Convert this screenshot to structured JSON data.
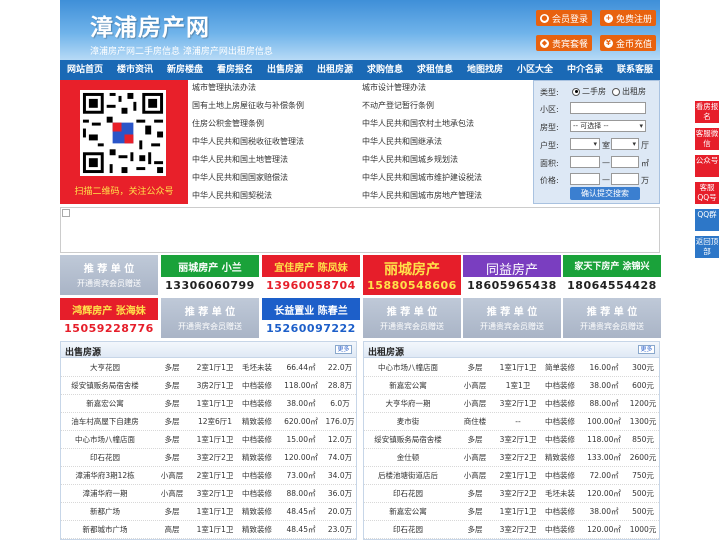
{
  "header": {
    "logo": "漳浦房产网",
    "slogan": "漳浦房产网二手房信息   漳浦房产网出租房信息",
    "buttons": [
      "会员登录",
      "免费注册",
      "贵宾套餐",
      "金币充值"
    ],
    "button_color": "#e8620f"
  },
  "nav": [
    "网站首页",
    "楼市资讯",
    "新房楼盘",
    "看房报名",
    "出售房源",
    "出租房源",
    "求购信息",
    "求租信息",
    "地图找房",
    "小区大全",
    "中介名录",
    "联系客服"
  ],
  "qr": {
    "caption": "扫描二维码，关注公众号"
  },
  "links_left": [
    "城市管理执法办法",
    "国有土地上房屋征收与补偿条例",
    "住房公积金管理条例",
    "中华人民共和国税收征收管理法",
    "中华人民共和国土地管理法",
    "中华人民共和国国家赔偿法",
    "中华人民共和国契税法"
  ],
  "links_right": [
    "城市设计管理办法",
    "不动产登记暂行条例",
    "中华人民共和国农村土地承包法",
    "中华人民共和国继承法",
    "中华人民共和国城乡规划法",
    "中华人民共和国城市维护建设税法",
    "中华人民共和国城市房地产管理法"
  ],
  "search": {
    "type_label": "类型:",
    "type_options": [
      "二手房",
      "出租房"
    ],
    "community_label": "小区:",
    "housetype_label": "房型:",
    "housetype_value": "-- 可选择 --",
    "layout_label": "户型:",
    "layout_unit1": "室",
    "layout_unit2": "厅",
    "area_label": "面积:",
    "area_unit": "㎡",
    "price_label": "价格:",
    "price_unit": "万",
    "submit": "确认提交搜索"
  },
  "ads_row1": [
    {
      "l1": "推 荐 单 位",
      "l2": "开通贵宾会员赠送",
      "style": "gray"
    },
    {
      "l1": "丽城房产   小兰",
      "l2": "13306060799",
      "style": "green"
    },
    {
      "l1": "宜佳房产 陈凤妹",
      "l2": "13960058704",
      "style": "red"
    },
    {
      "l1": "丽城房产",
      "l2": "15880548606",
      "style": "redbig"
    },
    {
      "l1": "同益房产",
      "l2": "18605965438",
      "style": "purple"
    },
    {
      "l1": "家天下房产 涂锦兴",
      "l2": "18064554428",
      "style": "green2"
    }
  ],
  "ads_row2": [
    {
      "l1": "鸿辉房产 张海妹",
      "l2": "15059228776",
      "style": "red"
    },
    {
      "l1": "推 荐 单 位",
      "l2": "开通贵宾会员赠送",
      "style": "gray"
    },
    {
      "l1": "长益置业 陈春兰",
      "l2": "15260097222",
      "style": "blue"
    },
    {
      "l1": "推 荐 单 位",
      "l2": "开通贵宾会员赠送",
      "style": "gray"
    },
    {
      "l1": "推 荐 单 位",
      "l2": "开通贵宾会员赠送",
      "style": "gray"
    },
    {
      "l1": "推 荐 单 位",
      "l2": "开通贵宾会员赠送",
      "style": "gray"
    }
  ],
  "sale": {
    "title": "出售房源",
    "more": "更多",
    "rows": [
      [
        "大亨花园",
        "多层",
        "2室1厅1卫",
        "毛坯未装",
        "66.44㎡",
        "22.0万"
      ],
      [
        "绥安镇贩务局宿舍楼",
        "多层",
        "3房2厅1卫",
        "中档装修",
        "118.00㎡",
        "28.8万"
      ],
      [
        "新嘉宏公寓",
        "多层",
        "1室1厅1卫",
        "中档装修",
        "38.00㎡",
        "6.0万"
      ],
      [
        "油车村高屋下自建房",
        "多层",
        "12室6厅1",
        "精致装修",
        "620.00㎡",
        "176.0万"
      ],
      [
        "中心市场八幢店面",
        "多层",
        "1室1厅1卫",
        "中档装修",
        "15.00㎡",
        "12.0万"
      ],
      [
        "印石花园",
        "多层",
        "3室2厅2卫",
        "精致装修",
        "120.00㎡",
        "74.0万"
      ],
      [
        "漳浦华府3期12栋",
        "小高层",
        "2室1厅1卫",
        "中档装修",
        "73.00㎡",
        "34.0万"
      ],
      [
        "漳浦华府一期",
        "小高层",
        "3室2厅1卫",
        "中档装修",
        "88.00㎡",
        "36.0万"
      ],
      [
        "新都广场",
        "多层",
        "1室1厅1卫",
        "精致装修",
        "48.45㎡",
        "20.0万"
      ],
      [
        "新都城市广场",
        "高层",
        "1室1厅1卫",
        "精致装修",
        "48.45㎡",
        "23.0万"
      ]
    ]
  },
  "rent": {
    "title": "出租房源",
    "more": "更多",
    "rows": [
      [
        "中心市场八幢店面",
        "多层",
        "1室1厅1卫",
        "简单装修",
        "16.00㎡",
        "300元"
      ],
      [
        "新嘉宏公寓",
        "小高层",
        "1室1卫",
        "中档装修",
        "38.00㎡",
        "600元"
      ],
      [
        "大亨华府一期",
        "小高层",
        "3室2厅1卫",
        "中档装修",
        "88.00㎡",
        "1200元"
      ],
      [
        "麦市街",
        "商住楼",
        "--",
        "中档装修",
        "100.00㎡",
        "1300元"
      ],
      [
        "绥安镇贩务局宿舍楼",
        "多层",
        "3室2厅1卫",
        "中档装修",
        "118.00㎡",
        "850元"
      ],
      [
        "金仕顿",
        "小高层",
        "3室2厅2卫",
        "精致装修",
        "133.00㎡",
        "2600元"
      ],
      [
        "后楼池塘街道店后",
        "小高层",
        "2室1厅1卫",
        "中档装修",
        "72.00㎡",
        "750元"
      ],
      [
        "印石花园",
        "多层",
        "3室2厅2卫",
        "毛坯未装",
        "120.00㎡",
        "500元"
      ],
      [
        "新嘉宏公寓",
        "多层",
        "1室1厅1卫",
        "中档装修",
        "38.00㎡",
        "500元"
      ],
      [
        "印石花园",
        "多层",
        "3室2厅2卫",
        "中档装修",
        "120.00㎡",
        "1000元"
      ]
    ]
  },
  "side_buttons": [
    {
      "label": "看房报名",
      "color": "red"
    },
    {
      "label": "客服微信",
      "color": "red"
    },
    {
      "label": "公众号",
      "color": "red"
    },
    {
      "label": "客服QQ号",
      "color": "red"
    },
    {
      "label": "QQ群",
      "color": "blue"
    },
    {
      "label": "返回顶部",
      "color": "blue"
    }
  ]
}
